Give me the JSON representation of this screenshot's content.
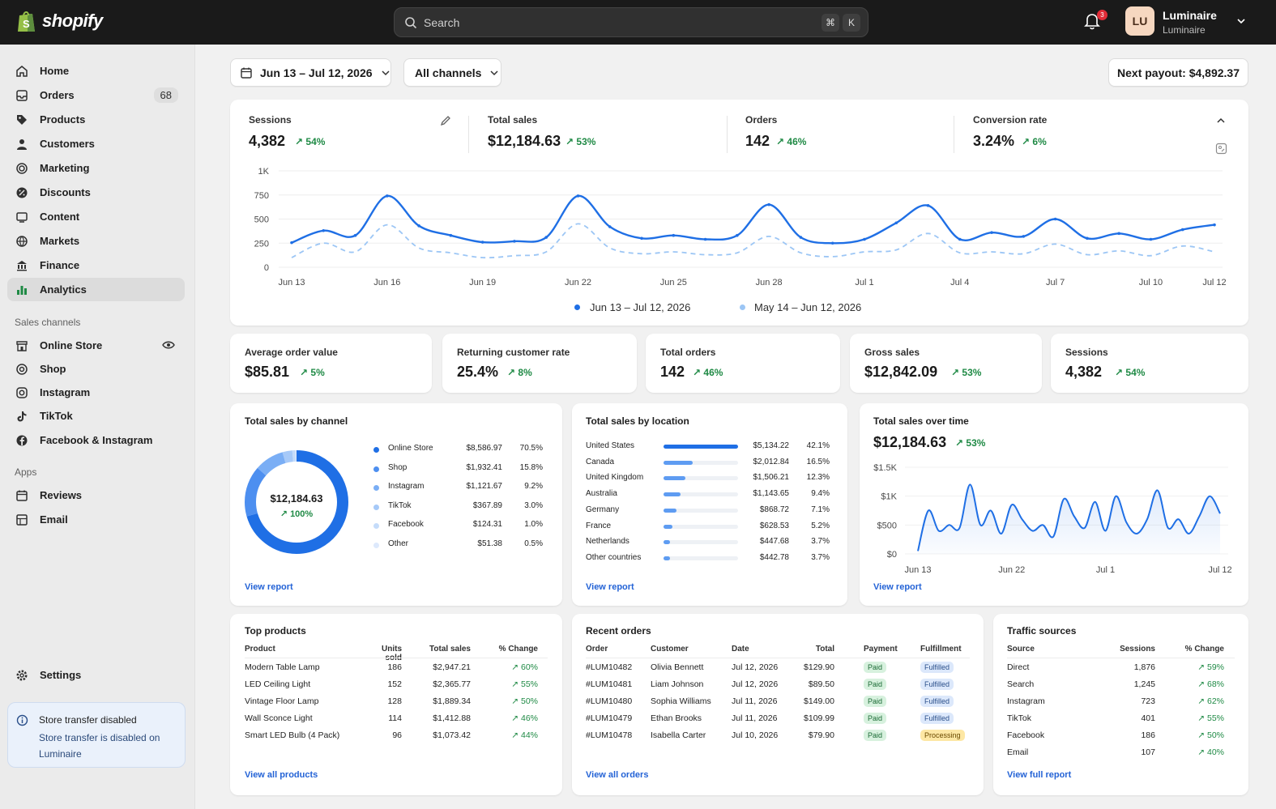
{
  "topbar": {
    "brand": "shopify",
    "search_placeholder": "Search",
    "kbd_cmd": "⌘",
    "kbd_k": "K",
    "notif_count": "3",
    "avatar_initials": "LU",
    "store_name": "Luminaire",
    "store_sub": "Luminaire"
  },
  "sidebar": {
    "items": [
      {
        "label": "Home"
      },
      {
        "label": "Orders",
        "count": "68"
      },
      {
        "label": "Products"
      },
      {
        "label": "Customers"
      },
      {
        "label": "Marketing"
      },
      {
        "label": "Discounts"
      },
      {
        "label": "Content"
      },
      {
        "label": "Markets"
      },
      {
        "label": "Finance"
      },
      {
        "label": "Analytics"
      }
    ],
    "sales_channels_title": "Sales channels",
    "channels": [
      {
        "label": "Online Store"
      },
      {
        "label": "Shop"
      },
      {
        "label": "Instagram"
      },
      {
        "label": "TikTok"
      },
      {
        "label": "Facebook & Instagram"
      }
    ],
    "apps_title": "Apps",
    "apps": [
      {
        "label": "Reviews"
      },
      {
        "label": "Email"
      }
    ],
    "settings": "Settings",
    "notice_title": "Store transfer disabled",
    "notice_body": "Store transfer is disabled on Luminaire"
  },
  "toolbar": {
    "date_range": "Jun 13 – Jul 12, 2026",
    "channels": "All channels",
    "payout": "Next payout: $4,892.37"
  },
  "overview": {
    "metrics": [
      {
        "label": "Sessions",
        "value": "4,382",
        "trend": "54%"
      },
      {
        "label": "Total sales",
        "value": "$12,184.63",
        "trend": "53%"
      },
      {
        "label": "Orders",
        "value": "142",
        "trend": "46%"
      },
      {
        "label": "Conversion rate",
        "value": "3.24%",
        "trend": "6%"
      }
    ],
    "legend_current": "Jun 13 – Jul 12, 2026",
    "legend_previous": "May 14 – Jun 12, 2026"
  },
  "chart_data": [
    {
      "type": "line",
      "x": [
        "Jun 13",
        "Jun 14",
        "Jun 15",
        "Jun 16",
        "Jun 17",
        "Jun 18",
        "Jun 19",
        "Jun 20",
        "Jun 21",
        "Jun 22",
        "Jun 23",
        "Jun 24",
        "Jun 25",
        "Jun 26",
        "Jun 27",
        "Jun 28",
        "Jun 29",
        "Jun 30",
        "Jul 1",
        "Jul 2",
        "Jul 3",
        "Jul 4",
        "Jul 5",
        "Jul 6",
        "Jul 7",
        "Jul 8",
        "Jul 9",
        "Jul 10",
        "Jul 11",
        "Jul 12"
      ],
      "xticks": [
        "Jun 13",
        "Jun 16",
        "Jun 19",
        "Jun 22",
        "Jun 25",
        "Jun 28",
        "Jul 1",
        "Jul 4",
        "Jul 7",
        "Jul 10",
        "Jul 12"
      ],
      "yticks": [
        "0",
        "250",
        "500",
        "750",
        "1K"
      ],
      "ylim": [
        0,
        1000
      ],
      "series": [
        {
          "name": "Jun 13 – Jul 12, 2026",
          "color": "#1f6fe5",
          "values": [
            255,
            380,
            330,
            740,
            430,
            330,
            260,
            270,
            310,
            740,
            420,
            300,
            330,
            290,
            330,
            650,
            310,
            250,
            290,
            460,
            640,
            290,
            360,
            320,
            500,
            300,
            350,
            290,
            390,
            440
          ]
        },
        {
          "name": "May 14 – Jun 12, 2026",
          "color": "#9cc6f5",
          "values": [
            100,
            250,
            160,
            440,
            200,
            150,
            100,
            120,
            160,
            450,
            200,
            140,
            160,
            130,
            150,
            320,
            150,
            110,
            160,
            180,
            350,
            150,
            160,
            140,
            240,
            130,
            170,
            120,
            220,
            160
          ]
        }
      ]
    },
    {
      "type": "pie",
      "title": "Total sales by channel",
      "center_value": "$12,184.63",
      "center_trend": "100%",
      "slices": [
        {
          "name": "Online Store",
          "value": 8586.97,
          "label": "$8,586.97",
          "pct": "70.5%",
          "color": "#1f6fe5"
        },
        {
          "name": "Shop",
          "value": 1932.41,
          "label": "$1,932.41",
          "pct": "15.8%",
          "color": "#4d8ff0"
        },
        {
          "name": "Instagram",
          "value": 1121.67,
          "label": "$1,121.67",
          "pct": "9.2%",
          "color": "#7aaef5"
        },
        {
          "name": "TikTok",
          "value": 367.89,
          "label": "$367.89",
          "pct": "3.0%",
          "color": "#a6c9f8"
        },
        {
          "name": "Facebook",
          "value": 124.31,
          "label": "$124.31",
          "pct": "1.0%",
          "color": "#c5dcfa"
        },
        {
          "name": "Other",
          "value": 51.38,
          "label": "$51.38",
          "pct": "0.5%",
          "color": "#dde9fc"
        }
      ]
    },
    {
      "type": "bar",
      "title": "Total sales by location",
      "categories": [
        "United States",
        "Canada",
        "United Kingdom",
        "Australia",
        "Germany",
        "France",
        "Netherlands",
        "Other countries"
      ],
      "values": [
        5134.22,
        2012.84,
        1506.21,
        1143.65,
        868.72,
        628.53,
        447.68,
        442.78
      ],
      "labels": [
        "$5,134.22",
        "$2,012.84",
        "$1,506.21",
        "$1,143.65",
        "$868.72",
        "$628.53",
        "$447.68",
        "$442.78"
      ],
      "pcts": [
        "42.1%",
        "16.5%",
        "12.3%",
        "9.4%",
        "7.1%",
        "5.2%",
        "3.7%",
        "3.7%"
      ]
    },
    {
      "type": "area",
      "title": "Total sales over time",
      "total": "$12,184.63",
      "trend": "53%",
      "x": [
        "Jun 13",
        "Jun 14",
        "Jun 15",
        "Jun 16",
        "Jun 17",
        "Jun 18",
        "Jun 19",
        "Jun 20",
        "Jun 21",
        "Jun 22",
        "Jun 23",
        "Jun 24",
        "Jun 25",
        "Jun 26",
        "Jun 27",
        "Jun 28",
        "Jun 29",
        "Jun 30",
        "Jul 1",
        "Jul 2",
        "Jul 3",
        "Jul 4",
        "Jul 5",
        "Jul 6",
        "Jul 7",
        "Jul 8",
        "Jul 9",
        "Jul 10",
        "Jul 11",
        "Jul 12"
      ],
      "xticks": [
        "Jun 13",
        "Jun 22",
        "Jul 1",
        "Jul 12"
      ],
      "yticks": [
        "$0",
        "$500",
        "$1K",
        "$1.5K"
      ],
      "ylim": [
        0,
        1500
      ],
      "values": [
        50,
        750,
        400,
        500,
        450,
        1200,
        500,
        750,
        350,
        850,
        600,
        400,
        500,
        300,
        950,
        650,
        450,
        900,
        400,
        1000,
        550,
        350,
        600,
        1100,
        450,
        600,
        350,
        650,
        1000,
        700
      ]
    }
  ],
  "cards": {
    "aov": {
      "label": "Average order value",
      "value": "$85.81",
      "trend": "5%"
    },
    "returning": {
      "label": "Returning customer rate",
      "value": "25.4%",
      "trend": "8%"
    },
    "total_orders": {
      "label": "Total orders",
      "value": "142",
      "trend": "46%"
    },
    "gross_sales": {
      "label": "Gross sales",
      "value": "$12,842.09",
      "trend": "53%"
    },
    "sessions": {
      "label": "Sessions",
      "value": "4,382",
      "trend": "54%"
    },
    "view_report": "View report"
  },
  "top_products": {
    "title": "Top products",
    "headers": [
      "Product",
      "Units sold",
      "Total sales",
      "% Change"
    ],
    "rows": [
      [
        "Modern Table Lamp",
        "186",
        "$2,947.21",
        "60%"
      ],
      [
        "LED Ceiling Light",
        "152",
        "$2,365.77",
        "55%"
      ],
      [
        "Vintage Floor Lamp",
        "128",
        "$1,889.34",
        "50%"
      ],
      [
        "Wall Sconce Light",
        "114",
        "$1,412.88",
        "46%"
      ],
      [
        "Smart LED Bulb (4 Pack)",
        "96",
        "$1,073.42",
        "44%"
      ]
    ],
    "link": "View all products"
  },
  "recent_orders": {
    "title": "Recent orders",
    "headers": [
      "Order",
      "Customer",
      "Date",
      "Total",
      "Payment",
      "Fulfillment"
    ],
    "rows": [
      [
        "#LUM10482",
        "Olivia Bennett",
        "Jul 12, 2026",
        "$129.90",
        "Paid",
        "Fulfilled"
      ],
      [
        "#LUM10481",
        "Liam Johnson",
        "Jul 12, 2026",
        "$89.50",
        "Paid",
        "Fulfilled"
      ],
      [
        "#LUM10480",
        "Sophia Williams",
        "Jul 11, 2026",
        "$149.00",
        "Paid",
        "Fulfilled"
      ],
      [
        "#LUM10479",
        "Ethan Brooks",
        "Jul 11, 2026",
        "$109.99",
        "Paid",
        "Fulfilled"
      ],
      [
        "#LUM10478",
        "Isabella Carter",
        "Jul 10, 2026",
        "$79.90",
        "Paid",
        "Processing"
      ]
    ],
    "link": "View all orders"
  },
  "traffic": {
    "title": "Traffic sources",
    "headers": [
      "Source",
      "Sessions",
      "% Change"
    ],
    "rows": [
      [
        "Direct",
        "1,876",
        "59%"
      ],
      [
        "Search",
        "1,245",
        "68%"
      ],
      [
        "Instagram",
        "723",
        "62%"
      ],
      [
        "TikTok",
        "401",
        "55%"
      ],
      [
        "Facebook",
        "186",
        "50%"
      ],
      [
        "Email",
        "107",
        "40%"
      ]
    ],
    "link": "View full report"
  }
}
